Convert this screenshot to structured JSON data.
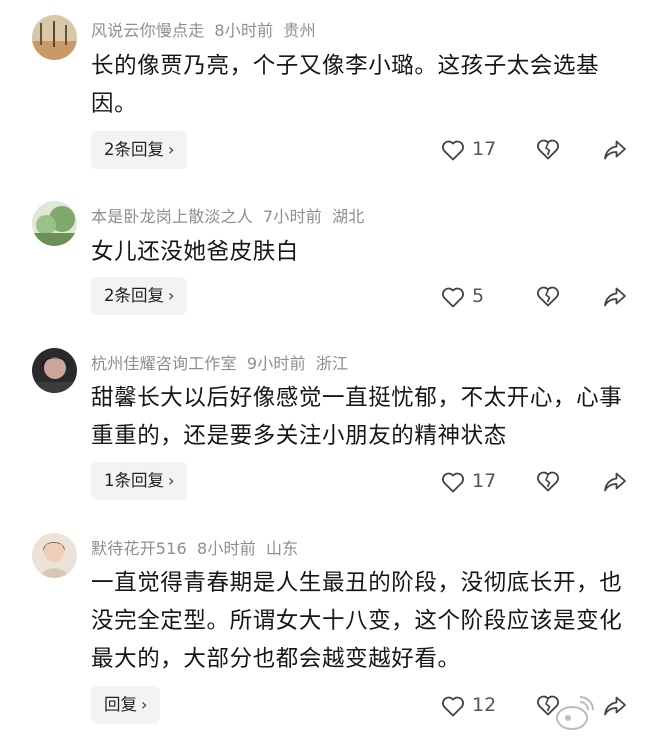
{
  "comments": [
    {
      "username": "风说云你慢点走",
      "time": "8小时前",
      "location": "贵州",
      "text": "长的像贾乃亮，个子又像李小璐。这孩子太会选基因。",
      "replies_label": "2条回复",
      "likes": "17"
    },
    {
      "username": "本是卧龙岗上散淡之人",
      "time": "7小时前",
      "location": "湖北",
      "text": "女儿还没她爸皮肤白",
      "replies_label": "2条回复",
      "likes": "5"
    },
    {
      "username": "杭州佳耀咨询工作室",
      "time": "9小时前",
      "location": "浙江",
      "text": "甜馨长大以后好像感觉一直挺忧郁，不太开心，心事重重的，还是要多关注小朋友的精神状态",
      "replies_label": "1条回复",
      "likes": "17"
    },
    {
      "username": "默待花开516",
      "time": "8小时前",
      "location": "山东",
      "text": "一直觉得青春期是人生最丑的阶段，没彻底长开，也没完全定型。所谓女大十八变，这个阶段应该是变化最大的，大部分也都会越变越好看。",
      "replies_label": "回复",
      "likes": "12"
    }
  ],
  "icons": {
    "like": "heart-outline-icon",
    "dislike": "broken-heart-icon",
    "share": "share-arrow-icon",
    "replies_chevron": "chevron-right-icon"
  }
}
